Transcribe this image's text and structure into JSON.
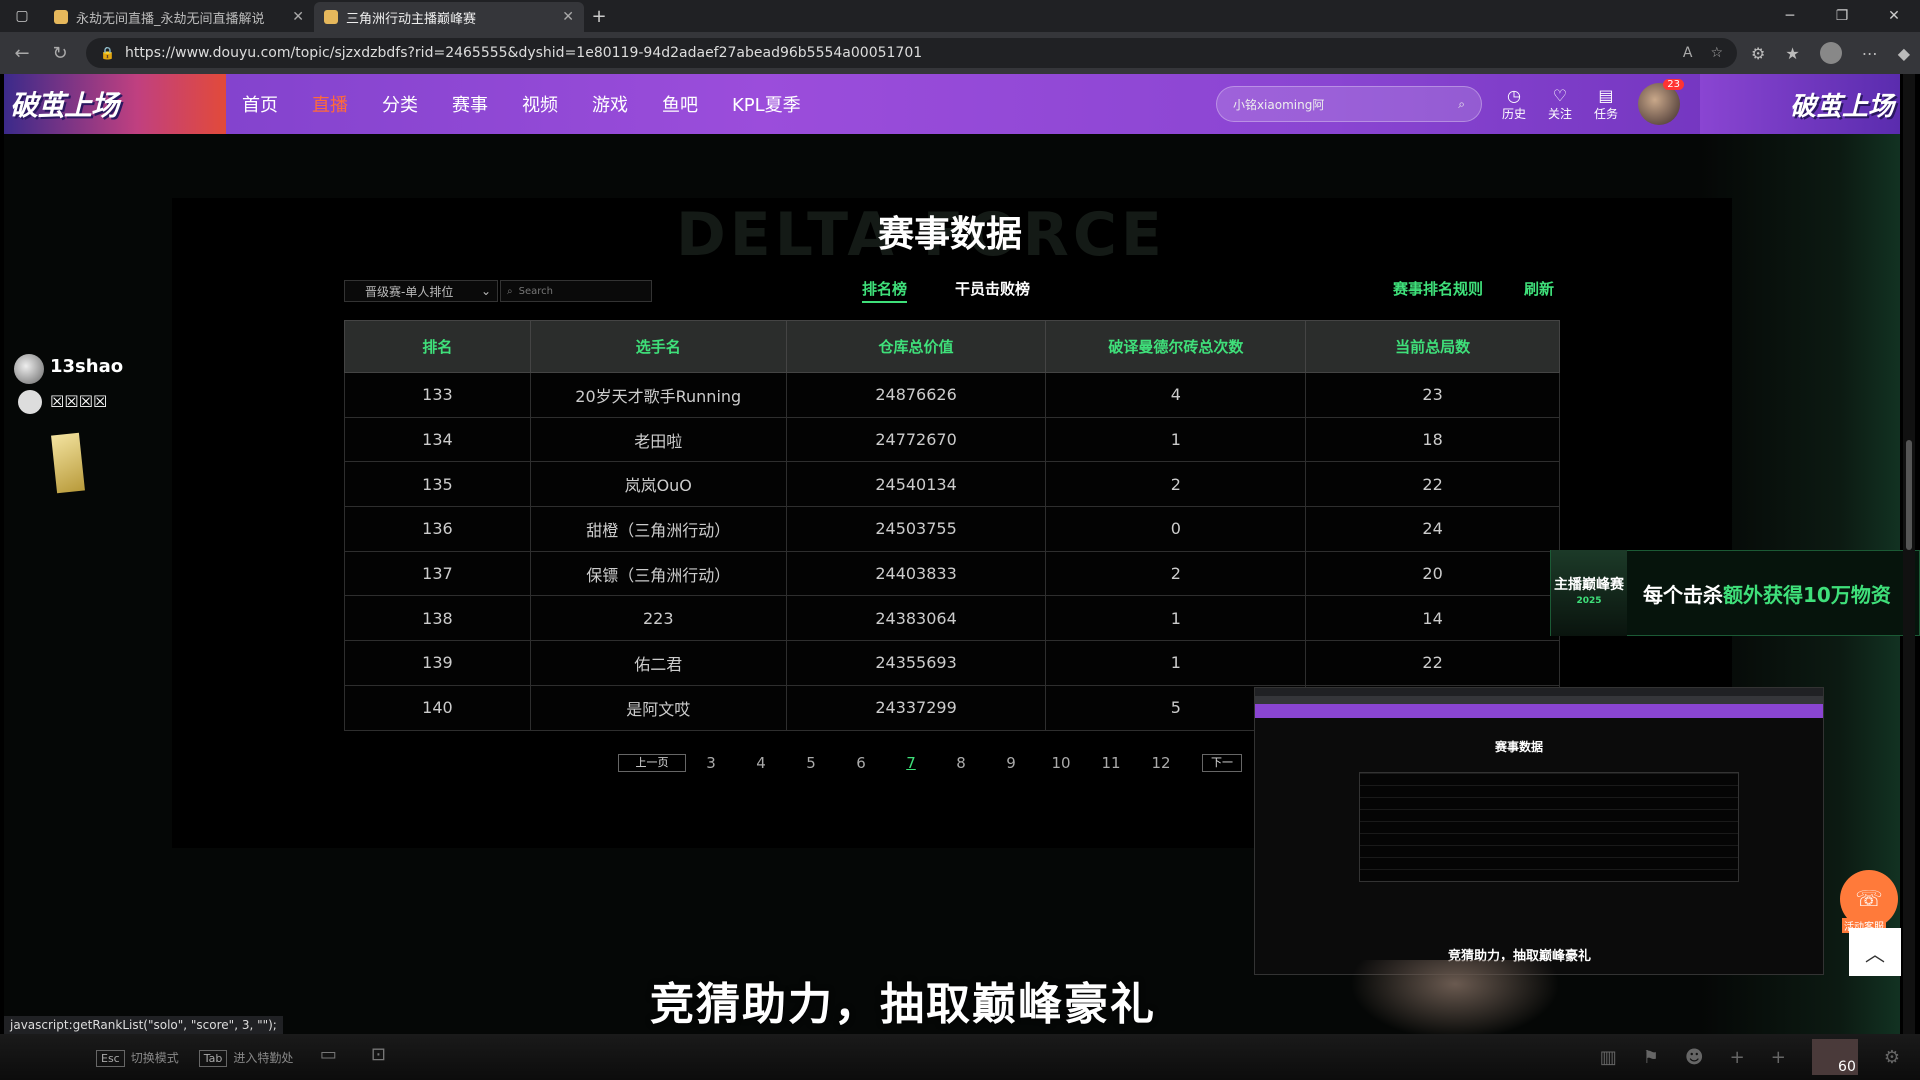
{
  "browser": {
    "tabs": [
      {
        "title": "永劫无间直播_永劫无间直播解说",
        "active": false
      },
      {
        "title": "三角洲行动主播巅峰赛",
        "active": true
      }
    ],
    "url": "https://www.douyu.com/topic/sjzxdzbdfs?rid=2465555&dyshid=1e80119-94d2adaef27abead96b5554a00051701"
  },
  "header": {
    "logo_text": "破茧上场",
    "nav": [
      "首页",
      "直播",
      "分类",
      "赛事",
      "视频",
      "游戏",
      "鱼吧",
      "KPL夏季"
    ],
    "search_placeholder": "小铭xiaoming阿",
    "icons": [
      {
        "icon": "history-icon",
        "label": "历史"
      },
      {
        "icon": "follow-icon",
        "label": "关注"
      },
      {
        "icon": "task-icon",
        "label": "任务"
      }
    ],
    "avatar_badge": "23",
    "right_banner_text": "破茧上场"
  },
  "panel": {
    "bg_word": "DELTA FORCE",
    "title": "赛事数据",
    "filter_value": "晋级赛-单人排位",
    "search_placeholder": "Search",
    "tab_rank": "排名榜",
    "tab_kill": "干员击败榜",
    "link_rules": "赛事排名规则",
    "link_refresh": "刷新"
  },
  "table": {
    "headers": [
      "排名",
      "选手名",
      "仓库总价值",
      "破译曼德尔砖总次数",
      "当前总局数"
    ],
    "rows": [
      [
        "133",
        "20岁天才歌手Running",
        "24876626",
        "4",
        "23"
      ],
      [
        "134",
        "老田啦",
        "24772670",
        "1",
        "18"
      ],
      [
        "135",
        "岚岚OuO",
        "24540134",
        "2",
        "22"
      ],
      [
        "136",
        "甜橙（三角洲行动）",
        "24503755",
        "0",
        "24"
      ],
      [
        "137",
        "保镖（三角洲行动）",
        "24403833",
        "2",
        "20"
      ],
      [
        "138",
        "223",
        "24383064",
        "1",
        "14"
      ],
      [
        "139",
        "佑二君",
        "24355693",
        "1",
        "22"
      ],
      [
        "140",
        "是阿文哎",
        "24337299",
        "5",
        ""
      ]
    ]
  },
  "pager": {
    "prev": "上一页",
    "next": "下一",
    "pages": [
      "3",
      "4",
      "5",
      "6",
      "7",
      "8",
      "9",
      "10",
      "11",
      "12"
    ],
    "current": "7"
  },
  "overlay": {
    "streamer_name": "13shao",
    "streamer_sub": "☒☒☒☒",
    "promo_logo": "主播巅峰赛",
    "promo_year": "2025",
    "promo_text_prefix": "每个击杀",
    "promo_text_highlight": "额外获得10万物资",
    "pip_title": "赛事数据",
    "pip_caption": "竞猜助力，抽取巅峰豪礼",
    "bottom_caption": "竞猜助力，抽取巅峰豪礼",
    "service_label": "活动客服"
  },
  "status_url": "javascript:getRankList(\"solo\", \"score\", 3, \"\");",
  "game_bar": {
    "esc_key": "Esc",
    "esc_label": "切换模式",
    "tab_key": "Tab",
    "tab_label": "进入特勤处",
    "fps": "60"
  },
  "colors": {
    "accent_green": "#3fe07a",
    "header_purple": "#8a45d2",
    "live_orange": "#ff6a3a"
  }
}
